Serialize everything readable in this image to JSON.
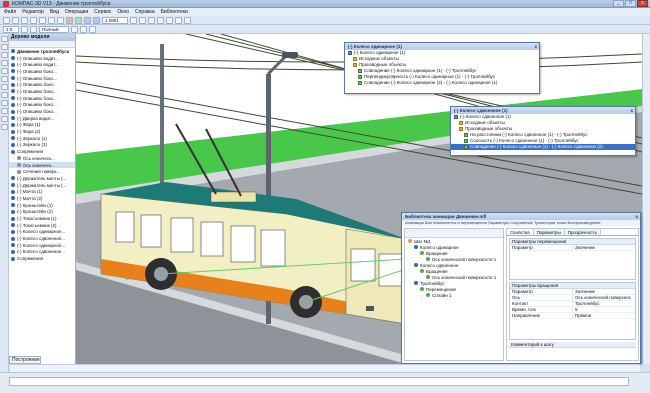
{
  "window": {
    "title": "КОМПАС-3D V13 - Движение троллейбуса",
    "controls": [
      "_",
      "□",
      "x"
    ]
  },
  "menu": [
    "Файл",
    "Редактор",
    "Вид",
    "Операции",
    "Сервис",
    "Окно",
    "Справка",
    "Библиотеки"
  ],
  "toolbar": {
    "zoom": "1.0801",
    "layer_combo": "Полный",
    "scale_combo": "1:0"
  },
  "tree_panel": {
    "title": "Дерево модели",
    "heading": "Движение троллейбуса",
    "rows": [
      {
        "label": "(-) Опишиво водит...",
        "indent": false
      },
      {
        "label": "(-) Опишиво водит...",
        "indent": false
      },
      {
        "label": "(-) Опишиво боко...",
        "indent": false
      },
      {
        "label": "(-) Опишиво боко...",
        "indent": false
      },
      {
        "label": "(-) Опишиво боко...",
        "indent": false
      },
      {
        "label": "(-) Опишиво боко...",
        "indent": false
      },
      {
        "label": "(-) Опишиво боко...",
        "indent": false
      },
      {
        "label": "(-) Опишиво боко...",
        "indent": false
      },
      {
        "label": "(-) Опишиво боко...",
        "indent": false
      },
      {
        "label": "(-) Дверка водит...",
        "indent": false
      },
      {
        "label": "(-) Фара (1)",
        "indent": false
      },
      {
        "label": "(-) Фара (2)",
        "indent": false
      },
      {
        "label": "(-) Зеркало (1)",
        "indent": false
      },
      {
        "label": "(-) Зеркало (2)",
        "indent": false
      },
      {
        "label": "Сопряжения",
        "indent": false
      },
      {
        "label": "Ось коническ...",
        "indent": true
      },
      {
        "label": "Ось коническ...",
        "indent": true,
        "highlight": true
      },
      {
        "label": "Сечение поверх...",
        "indent": true
      },
      {
        "label": "(-) Держатель мачты (...",
        "indent": false
      },
      {
        "label": "(-) Держатель мачты (...",
        "indent": false
      },
      {
        "label": "(-) Мачта (1)",
        "indent": false
      },
      {
        "label": "(-) Мачта (2)",
        "indent": false
      },
      {
        "label": "(-) Кронштейн (1)",
        "indent": false
      },
      {
        "label": "(-) Кронштейн (2)",
        "indent": false
      },
      {
        "label": "(-) Токосъемник (1)",
        "indent": false
      },
      {
        "label": "(-) Токосъемник (2)",
        "indent": false
      },
      {
        "label": "(-) Колесо одинарное...",
        "indent": false
      },
      {
        "label": "(-) Колесо сдвоенное...",
        "indent": false
      },
      {
        "label": "(-) Колесо одинарное...",
        "indent": false
      },
      {
        "label": "(-) Колесо сдвоенное...",
        "indent": false
      },
      {
        "label": "Сопряжения",
        "indent": false
      }
    ],
    "bottom_tab": "Построение"
  },
  "popup1": {
    "title": "(-) Колесо одинарное (1)",
    "rows": [
      {
        "label": "(-) Колесо одинарное (1)",
        "icon": "blue"
      },
      {
        "label": "Исходные объекты",
        "icon": "folder"
      },
      {
        "label": "Производные объекты",
        "icon": "folder"
      },
      {
        "label": "Совпадение (-) Колесо одинарное (1) - (-) Троллейбус",
        "icon": "green"
      },
      {
        "label": "Перпендикулярность (-) Колесо одинарное (1) - (-) Троллейбус",
        "icon": "green"
      },
      {
        "label": "Совпадение (-) Колесо одинарное (2) - (-) Колесо одинарное (1)",
        "icon": "green"
      }
    ]
  },
  "popup2": {
    "title": "(-) Колесо сдвоенное (1)",
    "rows": [
      {
        "label": "(-) Колесо сдвоенное (1)",
        "icon": "blue"
      },
      {
        "label": "Исходные объекты",
        "icon": "folder"
      },
      {
        "label": "Производные объекты",
        "icon": "folder"
      },
      {
        "label": "На расстоянии (-) Колесо сдвоенное (1) - (-) Троллейбус",
        "icon": "green"
      },
      {
        "label": "Соосность (-) Колесо сдвоенное (1) - (-) Троллейбус",
        "icon": "green"
      },
      {
        "label": "Совпадение (-) Колесо сдвоенное (1) - (-) Колесо сдвоенное (2)",
        "icon": "green",
        "selected": true
      }
    ]
  },
  "library": {
    "title": "Библиотека анимации Движение.mfl",
    "menu": "Анимация   Шаг   Компоненты и перемещения   Параметры   Сохранение   Траектория точки   Воспроизведение",
    "tree": [
      {
        "label": "Шаг №1",
        "level": 0
      },
      {
        "label": "Колесо одинарное",
        "level": 1
      },
      {
        "label": "Вращение",
        "level": 2
      },
      {
        "label": "Ось конической поверхности 1",
        "level": 3
      },
      {
        "label": "Колесо сдвоенное",
        "level": 1
      },
      {
        "label": "Вращение",
        "level": 2
      },
      {
        "label": "Ось конической поверхности 1",
        "level": 3
      },
      {
        "label": "Троллейбус",
        "level": 1
      },
      {
        "label": "Перемещение",
        "level": 2
      },
      {
        "label": "Сплайн 1",
        "level": 3
      }
    ],
    "tabs": [
      "Свойства",
      "Параметры",
      "Прозрачность"
    ],
    "grid1": {
      "title": "Параметры перемещения",
      "headers": [
        "Параметр",
        "Значение"
      ]
    },
    "grid2": {
      "title": "Параметры вращения",
      "headers": [
        "Параметр",
        "Значение"
      ],
      "rows": [
        [
          "Ось",
          "Ось конической поверхнос"
        ],
        [
          "Контакт",
          "Троллейбус"
        ],
        [
          "Время, Сек",
          "5"
        ],
        [
          "Направление",
          "Прямое"
        ]
      ]
    },
    "comment_label": "Комментарий к шагу"
  },
  "colors": {
    "bus_body": "#f3efc4",
    "bus_roof": "#1d7a76",
    "bus_stripe": "#e8801c",
    "grass": "#49c74a",
    "road": "#9aa1a8"
  }
}
